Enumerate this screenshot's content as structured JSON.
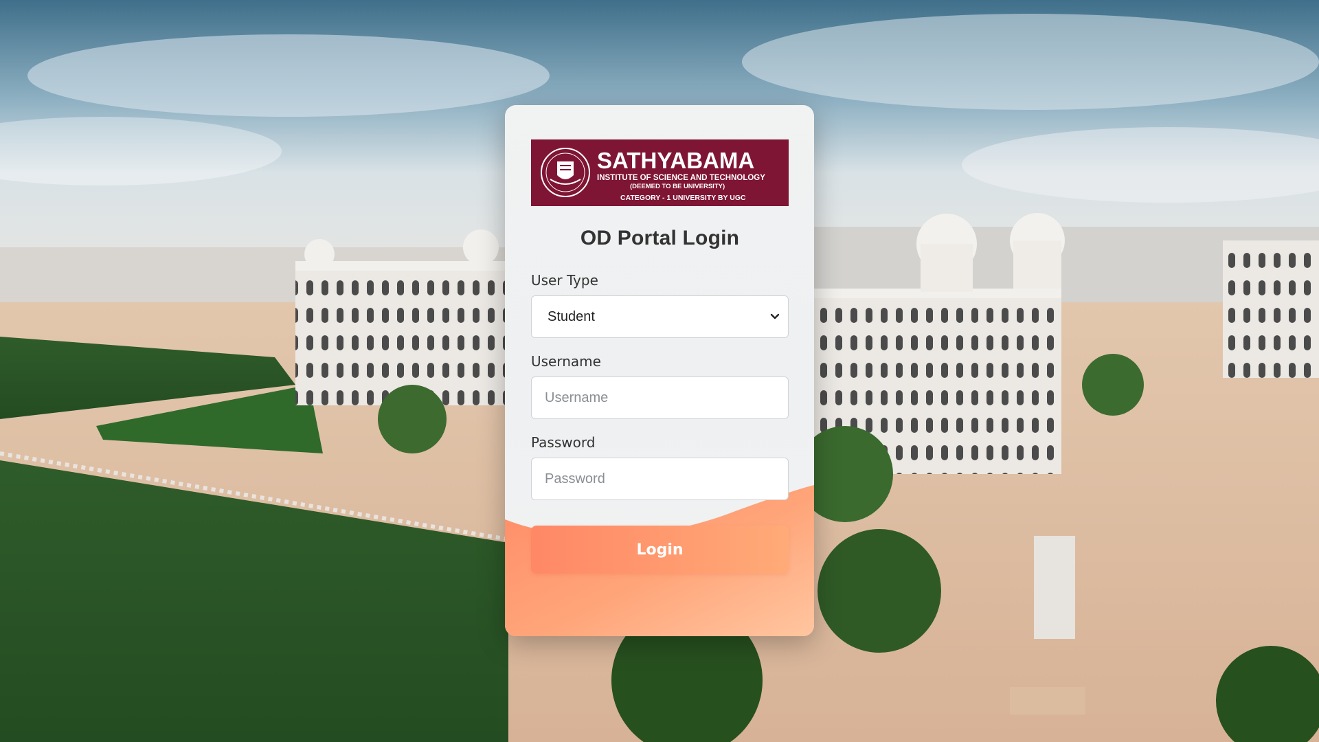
{
  "brand": {
    "logo_name": "SATHYABAMA",
    "logo_line1": "INSTITUTE OF SCIENCE AND TECHNOLOGY",
    "logo_line2": "(DEEMED TO BE UNIVERSITY)",
    "logo_line3": "CATEGORY - 1 UNIVERSITY BY UGC",
    "logo_color": "#7f1534"
  },
  "page": {
    "title": "OD Portal Login"
  },
  "form": {
    "user_type": {
      "label": "User Type",
      "selected": "Student",
      "options": [
        "Student"
      ]
    },
    "username": {
      "label": "Username",
      "value": "",
      "placeholder": "Username"
    },
    "password": {
      "label": "Password",
      "value": "",
      "placeholder": "Password"
    },
    "submit_label": "Login"
  },
  "colors": {
    "accent": "#ff8866",
    "accent_end": "#ffab78",
    "text": "#333333"
  },
  "icons": {
    "select_arrow": "chevron-down-icon",
    "logo_emblem": "university-emblem-icon"
  }
}
